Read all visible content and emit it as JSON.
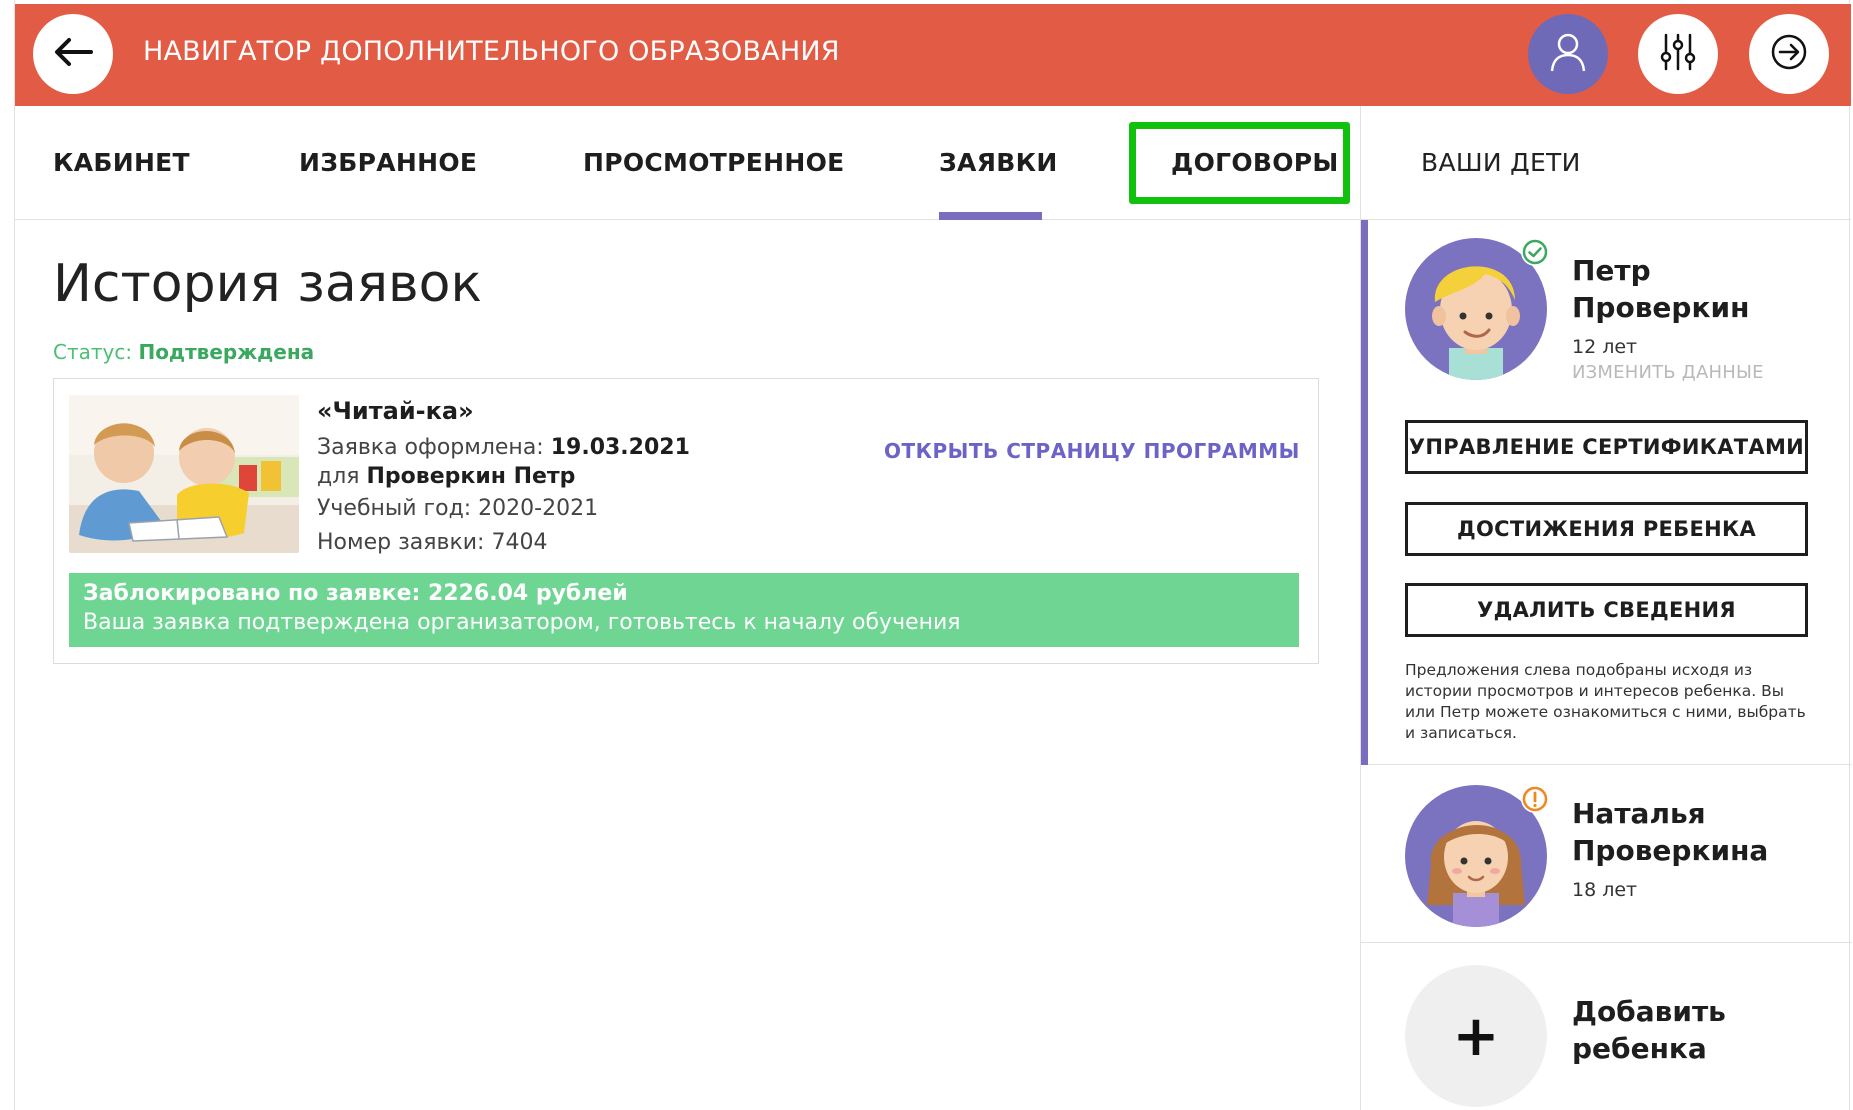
{
  "header": {
    "title": "НАВИГАТОР ДОПОЛНИТЕЛЬНОГО ОБРАЗОВАНИЯ",
    "accent_color": "#e25b45",
    "icons": [
      "arrow-left-icon",
      "user-icon",
      "sliders-icon",
      "logout-icon"
    ]
  },
  "tabs": [
    {
      "label": "КАБИНЕТ"
    },
    {
      "label": "ИЗБРАННОЕ"
    },
    {
      "label": "ПРОСМОТРЕННОЕ"
    },
    {
      "label": "ЗАЯВКИ",
      "active": true
    },
    {
      "label": "ДОГОВОРЫ",
      "highlighted": true
    }
  ],
  "active_tab_color": "#7a6cbf",
  "highlight_color": "#12c10e",
  "right_panel": {
    "title": "ВАШИ ДЕТИ"
  },
  "main": {
    "page_title": "История заявок",
    "status_label": "Статус:",
    "status_value": "Подтверждена",
    "application": {
      "program_name": "«Читай-ка»",
      "date_label": "Заявка оформлена:",
      "date_value": "19.03.2021",
      "for_label": "для",
      "for_value": "Проверкин Петр",
      "year_text": "Учебный год: 2020-2021",
      "number_text": "Номер заявки: 7404",
      "open_link": "ОТКРЫТЬ СТРАНИЦУ ПРОГРАММЫ",
      "blocked_text": "Заблокировано по заявке: 2226.04 рублей",
      "confirmation_text": "Ваша заявка подтверждена организатором, готовьтесь к началу обучения",
      "banner_color": "#6fd593"
    }
  },
  "children": [
    {
      "first_name": "Петр",
      "last_name": "Проверкин",
      "age": "12 лет",
      "edit_link": "ИЗМЕНИТЬ ДАННЫЕ",
      "badge_icon": "check-circle-icon",
      "buttons": [
        "УПРАВЛЕНИЕ СЕРТИФИКАТАМИ",
        "ДОСТИЖЕНИЯ РЕБЕНКА",
        "УДАЛИТЬ СВЕДЕНИЯ"
      ],
      "note": "Предложения слева подобраны исходя из истории просмотров и интересов ребенка. Вы или Петр можете ознакомиться с ними, выбрать и записаться."
    },
    {
      "first_name": "Наталья",
      "last_name": "Проверкина",
      "age": "18 лет",
      "badge_icon": "warning-circle-icon"
    }
  ],
  "add_child": {
    "symbol": "+",
    "line1": "Добавить",
    "line2": "ребенка"
  }
}
